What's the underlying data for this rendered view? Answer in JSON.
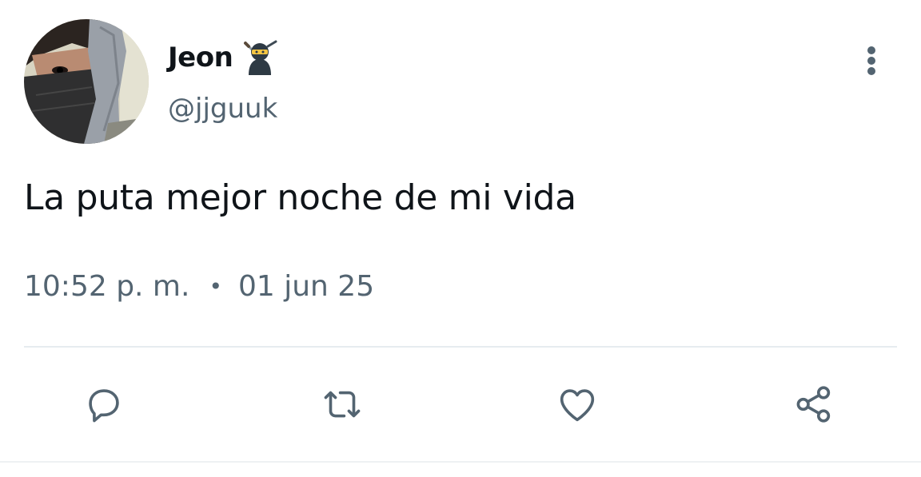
{
  "tweet": {
    "author": {
      "display_name": "Jeon",
      "name_emoji": "ninja-icon",
      "handle": "@jjguuk"
    },
    "text": "La puta mejor noche de mi vida",
    "time": "10:52 p. m.",
    "separator": "•",
    "date": "01 jun 25"
  },
  "actions": [
    "reply-icon",
    "retweet-icon",
    "like-icon",
    "share-icon"
  ],
  "colors": {
    "text": "#0f1419",
    "secondary": "#536471",
    "divider": "#e6ecf0"
  }
}
